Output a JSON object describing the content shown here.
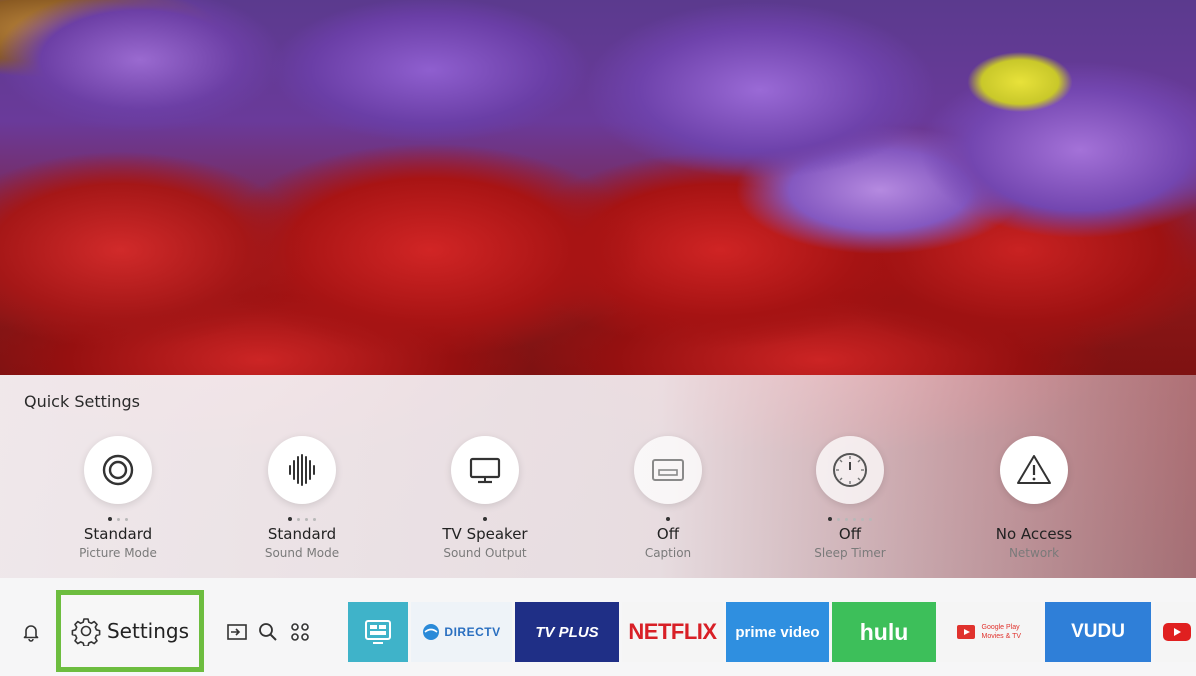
{
  "quick_settings": {
    "title": "Quick Settings",
    "items": [
      {
        "value": "Standard",
        "label": "Picture Mode",
        "icon": "picture-mode-icon",
        "dots": 3,
        "active": 0
      },
      {
        "value": "Standard",
        "label": "Sound Mode",
        "icon": "sound-mode-icon",
        "dots": 4,
        "active": 0
      },
      {
        "value": "TV Speaker",
        "label": "Sound Output",
        "icon": "tv-speaker-icon",
        "dots": 1,
        "active": 0
      },
      {
        "value": "Off",
        "label": "Caption",
        "icon": "caption-icon",
        "dots": 1,
        "active": 0
      },
      {
        "value": "Off",
        "label": "Sleep Timer",
        "icon": "sleep-timer-icon",
        "dots": 6,
        "active": 0
      },
      {
        "value": "No Access",
        "label": "Network",
        "icon": "network-warning-icon",
        "dots": 0,
        "active": -1
      }
    ]
  },
  "bottom_bar": {
    "settings_label": "Settings",
    "icons": [
      "notification-bell-icon",
      "source-input-icon",
      "search-icon",
      "apps-grid-icon"
    ],
    "apps": [
      {
        "name": "TV Guide",
        "text": "",
        "bg": "#3fb3c9",
        "fg": "#ffffff"
      },
      {
        "name": "DIRECTV",
        "text": "DIRECTV",
        "bg": "#eef3f8",
        "fg": "#2a6fc0"
      },
      {
        "name": "TV Plus",
        "text": "TV PLUS",
        "bg": "#1f2f86",
        "fg": "#ffffff"
      },
      {
        "name": "Netflix",
        "text": "NETFLIX",
        "bg": "#f5f5f5",
        "fg": "#d81f26"
      },
      {
        "name": "Prime Video",
        "text": "prime video",
        "bg": "#2f8fe0",
        "fg": "#ffffff"
      },
      {
        "name": "Hulu",
        "text": "hulu",
        "bg": "#3dbf5a",
        "fg": "#ffffff"
      },
      {
        "name": "Google Play Movies & TV",
        "text": "Google Play Movies & TV",
        "bg": "#f5f5f5",
        "fg": "#e0322d"
      },
      {
        "name": "VUDU",
        "text": "VUDU",
        "bg": "#2f7fd8",
        "fg": "#ffffff"
      },
      {
        "name": "YouTube",
        "text": "",
        "bg": "#f5f5f5",
        "fg": "#e02020"
      }
    ]
  },
  "colors": {
    "focus_border": "#6dbd3f",
    "panel_text": "#222222",
    "sub_text": "#7a7a7a"
  }
}
